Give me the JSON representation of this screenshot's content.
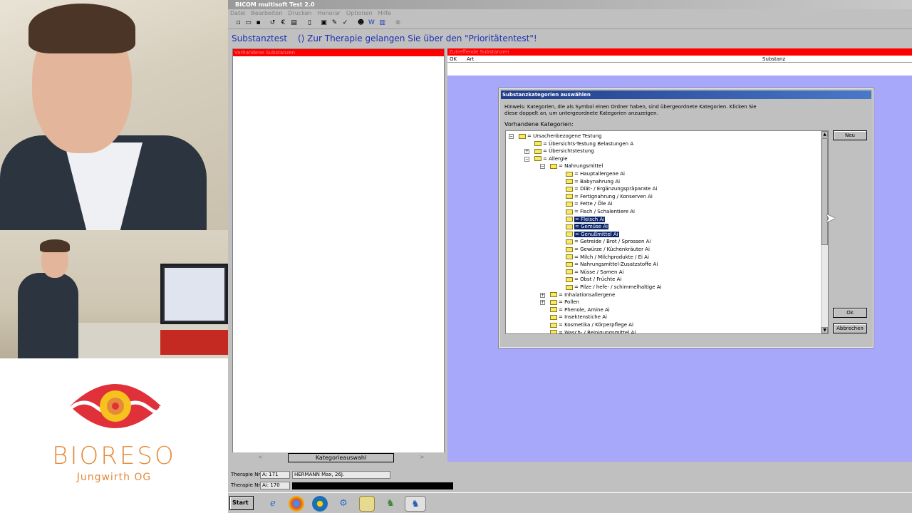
{
  "brand": {
    "name": "BIORESO",
    "subtitle": "Jungwirth OG",
    "colors": {
      "eye_red": "#e0303a",
      "orange": "#e58a3a",
      "iris_yellow": "#f6c21e"
    }
  },
  "app": {
    "title": "BICOM multisoft Test 2.0",
    "menu": [
      "Datei",
      "Bearbeiten",
      "Drucken",
      "Honorar",
      "Optionen",
      "Hilfe"
    ],
    "toolbar_icons": [
      "new-icon",
      "open-icon",
      "save-icon",
      "undo-icon",
      "euro-icon",
      "print-icon",
      "device-icon",
      "form-icon",
      "edit-icon",
      "check-icon",
      "person-icon",
      "word-icon",
      "chart-icon",
      "close-icon"
    ],
    "header": {
      "title": "Substanztest",
      "hint": "()  Zur Therapie gelangen Sie über den \"Prioritätentest\"!"
    },
    "left_panel": {
      "heading": "Vorhandene Substanzen",
      "nav_left": "<",
      "nav_right": ">",
      "button": "Kategorieauswahl"
    },
    "right_panel": {
      "heading": "Zutreffende Substanzen",
      "columns": [
        "OK",
        "Art",
        "Substanz"
      ]
    },
    "dialog": {
      "title": "Substanzkategorien auswählen",
      "hint": "Hinweis: Kategorien, die als Symbol einen Ordner haben, sind übergeordnete Kategorien. Klicken Sie diese doppelt an, um untergeordnete Kategorien anzuzeigen.",
      "label": "Vorhandene Kategorien:",
      "buttons": {
        "new": "Neu",
        "ok": "Ok",
        "cancel": "Abbrechen"
      },
      "tree": [
        {
          "label": "= Ursachenbezogene Testung",
          "level": 0,
          "expander": "minus"
        },
        {
          "label": "= Übersichts-Testung Belastungen A",
          "level": 1,
          "expander": ""
        },
        {
          "label": "= Übersichtstestung",
          "level": 1,
          "expander": "plus"
        },
        {
          "label": "= Allergie",
          "level": 1,
          "expander": "minus"
        },
        {
          "label": "= Nahrungsmittel",
          "level": 2,
          "expander": "minus"
        },
        {
          "label": "= Hauptallergene Ai",
          "level": 3,
          "expander": ""
        },
        {
          "label": "= Babynahrung Ai",
          "level": 3,
          "expander": ""
        },
        {
          "label": "= Diät- / Ergänzungspräparate Ai",
          "level": 3,
          "expander": ""
        },
        {
          "label": "= Fertignahrung / Konserven Ai",
          "level": 3,
          "expander": ""
        },
        {
          "label": "= Fette / Öle Ai",
          "level": 3,
          "expander": ""
        },
        {
          "label": "= Fisch / Schalentiere Ai",
          "level": 3,
          "expander": ""
        },
        {
          "label": "= Fleisch Ai",
          "level": 3,
          "expander": "",
          "selected": true
        },
        {
          "label": "= Gemüse Ai",
          "level": 3,
          "expander": "",
          "selected": true
        },
        {
          "label": "= Genußmittel Ai",
          "level": 3,
          "expander": "",
          "selected": true
        },
        {
          "label": "= Getreide / Brot / Sprossen Ai",
          "level": 3,
          "expander": ""
        },
        {
          "label": "= Gewürze / Küchenkräuter Ai",
          "level": 3,
          "expander": ""
        },
        {
          "label": "= Milch / Milchprodukte / Ei Ai",
          "level": 3,
          "expander": ""
        },
        {
          "label": "= Nahrungsmittel-Zusatzstoffe Ai",
          "level": 3,
          "expander": ""
        },
        {
          "label": "= Nüsse / Samen Ai",
          "level": 3,
          "expander": ""
        },
        {
          "label": "= Obst / Früchte  Ai",
          "level": 3,
          "expander": ""
        },
        {
          "label": "= Pilze / hefe- / schimmelhaltige Ai",
          "level": 3,
          "expander": ""
        },
        {
          "label": "= Inhalationsallergene",
          "level": 2,
          "expander": "plus"
        },
        {
          "label": "= Pollen",
          "level": 2,
          "expander": "plus"
        },
        {
          "label": "= Phenole, Amine Ai",
          "level": 2,
          "expander": ""
        },
        {
          "label": "= Insektenstiche Ai",
          "level": 2,
          "expander": ""
        },
        {
          "label": "= Kosmetika / Körperpflege Ai",
          "level": 2,
          "expander": ""
        },
        {
          "label": "= Wasch- / Reinigungsmittel Ai",
          "level": 2,
          "expander": ""
        }
      ]
    },
    "status": {
      "row1_label": "Therapie Nr.",
      "row1_id": "A: 171",
      "patient": "HERMANN Max, 26J.",
      "row2_label": "Therapie Nr.",
      "row2_id": "Ai: 170"
    },
    "taskbar": {
      "start": "Start",
      "apps": [
        "ie-icon",
        "chrome-icon",
        "network-icon",
        "tool-icon",
        "folder-icon",
        "bicom-icon",
        "bicom-active-icon"
      ]
    }
  }
}
